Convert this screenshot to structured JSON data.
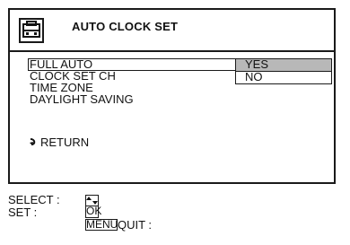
{
  "title": "AUTO CLOCK SET",
  "menu": {
    "items": [
      {
        "label": "FULL AUTO"
      },
      {
        "label": "CLOCK SET CH"
      },
      {
        "label": "TIME ZONE"
      },
      {
        "label": "DAYLIGHT SAVING"
      }
    ],
    "return_label": "RETURN"
  },
  "submenu": {
    "options": [
      {
        "label": "YES"
      },
      {
        "label": "NO"
      }
    ],
    "selected": "YES"
  },
  "footer": {
    "select_label": "SELECT :",
    "set_label": "SET :",
    "ok_key": "OK",
    "menu_key": "MENU",
    "quit_label": "QUIT :"
  },
  "icons": {
    "header": "tv-menu-icon",
    "return": "return-arrow-icon",
    "select": "up-down-arrows-icon"
  }
}
